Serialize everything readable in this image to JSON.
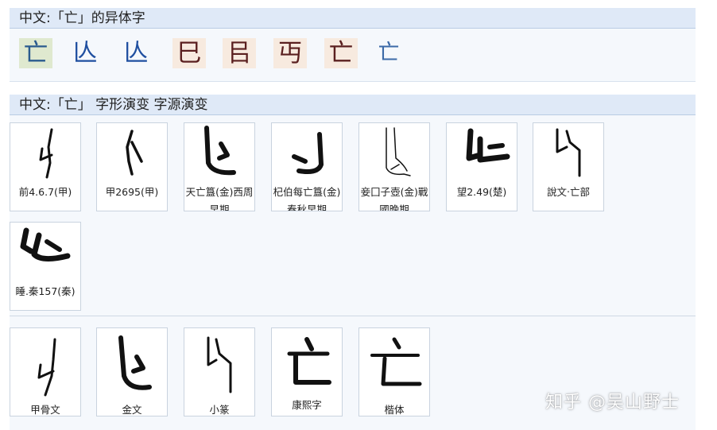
{
  "section1": {
    "title": "中文:「亡」的异体字"
  },
  "variants": [
    "亡",
    "亾",
    "亾",
    "巳",
    "㠯",
    "丏",
    "亡",
    "亡"
  ],
  "section2": {
    "title": "中文:「亡」 字形演变 字源演变"
  },
  "evolution": [
    {
      "caption": "前4.6.7(甲)"
    },
    {
      "caption": "甲2695(甲)"
    },
    {
      "caption": "天亡簋(金)西周早期"
    },
    {
      "caption": "杞伯每亡簋(金)春秋早期"
    },
    {
      "caption": "妾囗子壺(金)戰國晚期"
    },
    {
      "caption": "望2.49(楚)"
    },
    {
      "caption": "說文‧亡部"
    },
    {
      "caption": "睡.秦157(秦)"
    }
  ],
  "scripts": [
    {
      "caption": "甲骨文"
    },
    {
      "caption": "金文"
    },
    {
      "caption": "小篆"
    },
    {
      "caption": "康熙字"
    },
    {
      "caption": "楷体"
    }
  ],
  "watermark": "知乎 @吴山野士"
}
